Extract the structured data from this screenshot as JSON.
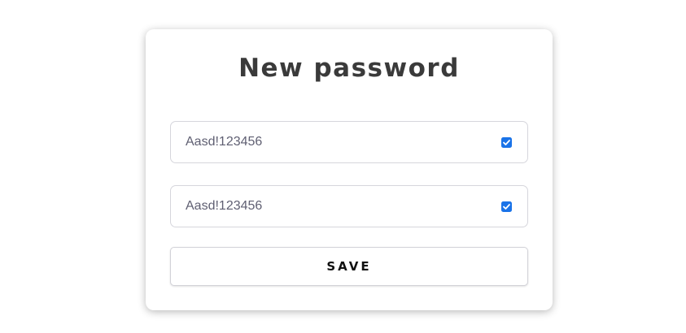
{
  "form": {
    "title": "New password",
    "fields": [
      {
        "value": "Aasd!123456",
        "show_password_checked": true
      },
      {
        "value": "Aasd!123456",
        "show_password_checked": true
      }
    ],
    "save_label": "SAVE"
  },
  "colors": {
    "title_text": "#3a3a3a",
    "input_text": "#5f5f72",
    "checkbox_accent": "#1a73e8",
    "field_border": "#d6d6dc"
  }
}
